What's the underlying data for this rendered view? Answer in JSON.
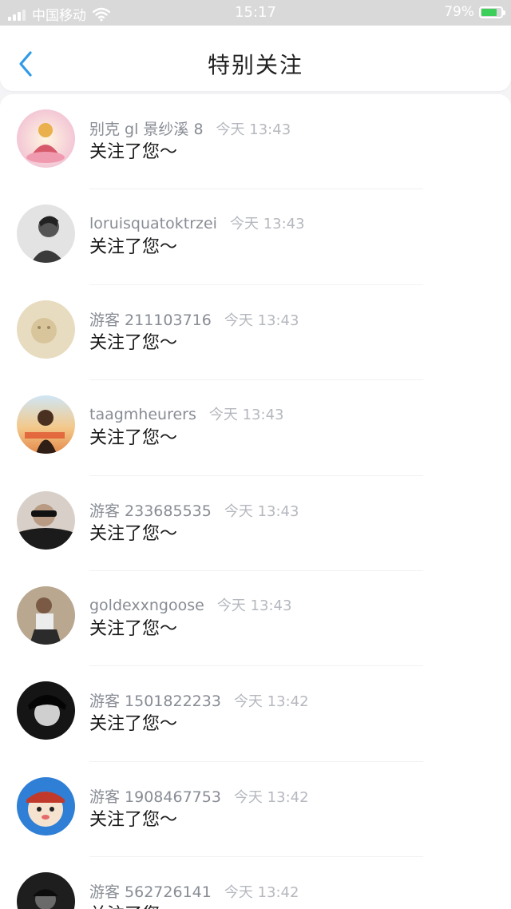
{
  "status_bar": {
    "carrier": "中国移动",
    "time": "15:17",
    "battery": "79%",
    "battery_level": 0.79,
    "wifi_icon": "wifi-icon",
    "signal_icon": "signal-icon"
  },
  "nav": {
    "title": "特别关注",
    "back_icon": "chevron-left-icon",
    "accent_color": "#2f9be8"
  },
  "items": [
    {
      "name": "别克 gl 景纱溪 8",
      "time": "今天 13:43",
      "message": "关注了您～"
    },
    {
      "name": "loruisquatoktrzei",
      "time": "今天 13:43",
      "message": "关注了您～"
    },
    {
      "name": "游客 211103716",
      "time": "今天 13:43",
      "message": "关注了您～"
    },
    {
      "name": "taagmheurers",
      "time": "今天 13:43",
      "message": "关注了您～"
    },
    {
      "name": "游客 233685535",
      "time": "今天 13:43",
      "message": "关注了您～"
    },
    {
      "name": "goldexxngoose",
      "time": "今天 13:43",
      "message": "关注了您～"
    },
    {
      "name": "游客 1501822233",
      "time": "今天 13:42",
      "message": "关注了您～"
    },
    {
      "name": "游客 1908467753",
      "time": "今天 13:42",
      "message": "关注了您～"
    },
    {
      "name": "游客 562726141",
      "time": "今天 13:42",
      "message": "关注了您～"
    }
  ]
}
